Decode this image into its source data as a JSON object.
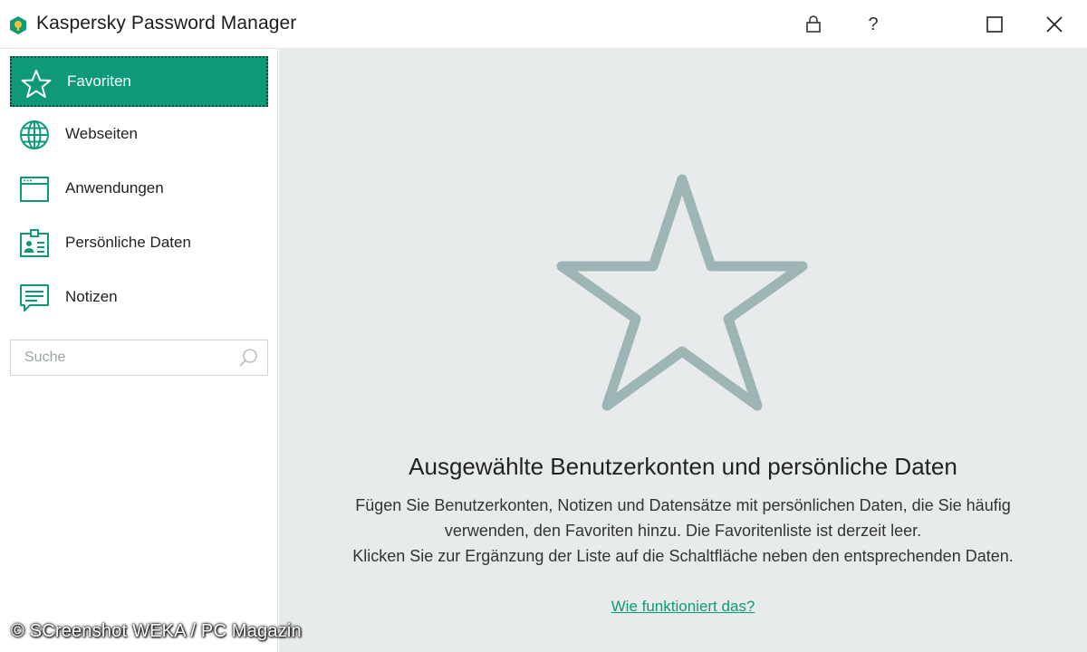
{
  "window": {
    "title": "Kaspersky Password Manager",
    "help_label": "?"
  },
  "sidebar": {
    "items": [
      {
        "label": "Favoriten",
        "icon": "star-icon",
        "active": true
      },
      {
        "label": "Webseiten",
        "icon": "globe-icon"
      },
      {
        "label": "Anwendungen",
        "icon": "application-window-icon"
      },
      {
        "label": "Persönliche Daten",
        "icon": "id-card-icon"
      },
      {
        "label": "Notizen",
        "icon": "note-icon"
      }
    ],
    "search_placeholder": "Suche"
  },
  "main": {
    "title": "Ausgewählte Benutzerkonten und persönliche Daten",
    "description_1": "Fügen Sie Benutzerkonten, Notizen und Datensätze mit persönlichen Daten, die Sie häufig verwenden, den Favoriten hinzu. Die Favoritenliste ist derzeit leer.",
    "description_2": "Klicken Sie zur Ergänzung der Liste auf die Schaltfläche neben den entsprechenden Daten.",
    "help_link": "Wie funktioniert das?"
  },
  "watermark": "© SCreenshot WEKA / PC Magazin",
  "colors": {
    "accent": "#0e9a78",
    "main_bg": "#e8ebec",
    "empty_star": "#9db5b4"
  }
}
